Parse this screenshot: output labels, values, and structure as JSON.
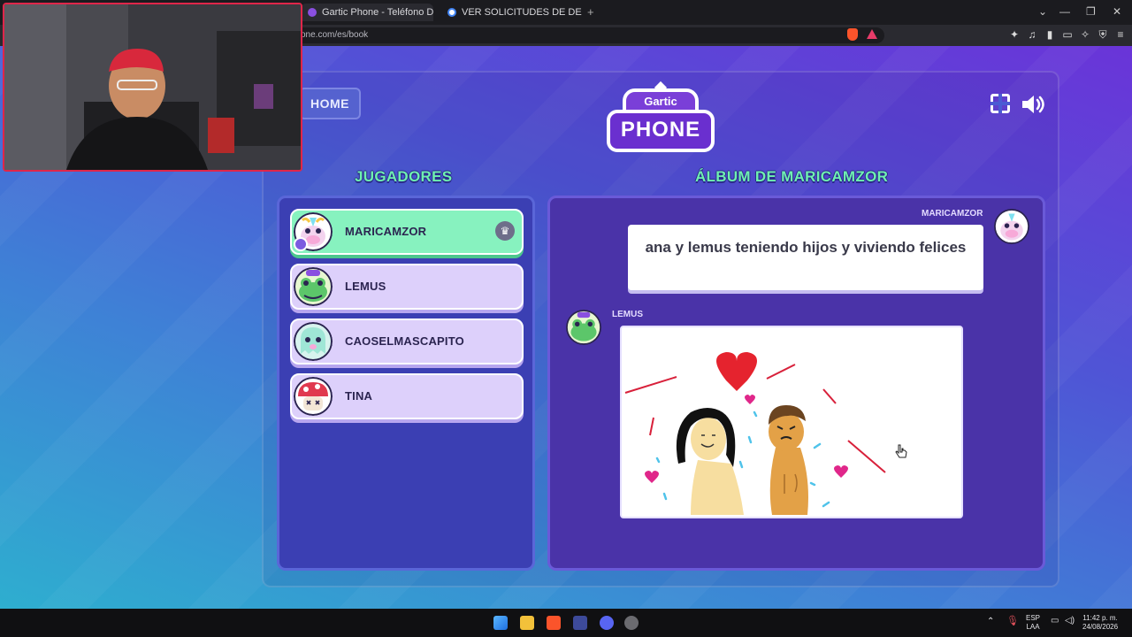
{
  "browser": {
    "tabs": [
      {
        "title": "Gartic Phone - Teléfono Descom",
        "active": true
      },
      {
        "title": "VER SOLICITUDES DE DESBANEO EN",
        "active": false
      }
    ],
    "new_tab_glyph": "+",
    "close_glyph": "✕",
    "url": "one.com/es/book",
    "window_controls": [
      "⌄",
      "—",
      "❐",
      "✕"
    ]
  },
  "game": {
    "home_label": "HOME",
    "logo": {
      "top": "Gartic",
      "bottom": "PHONE"
    },
    "players_title": "JUGADORES",
    "album_title": "ÁLBUM DE MARICAMZOR",
    "players": [
      {
        "name": "MARICAMZOR",
        "host": true,
        "avatar": "unicorn-cow-avatar"
      },
      {
        "name": "LEMUS",
        "host": false,
        "avatar": "frog-avatar"
      },
      {
        "name": "CAOSELMASCAPITO",
        "host": false,
        "avatar": "ghost-avatar"
      },
      {
        "name": "TINA",
        "host": false,
        "avatar": "mushroom-avatar"
      }
    ],
    "album": {
      "entries": [
        {
          "author": "MARICAMZOR",
          "type": "text",
          "content": "ana y lemus teniendo hijos y viviendo felices"
        },
        {
          "author": "LEMUS",
          "type": "drawing",
          "content": "drawing"
        }
      ]
    },
    "colors": {
      "accent_green": "#6ff0b0",
      "host_row": "#87f2bf",
      "player_row": "#ddd0fb"
    }
  },
  "taskbar": {
    "lang_top": "ESP",
    "lang_bottom": "LAA",
    "time": "11:42 p. m.",
    "date": "24/08/2026"
  }
}
